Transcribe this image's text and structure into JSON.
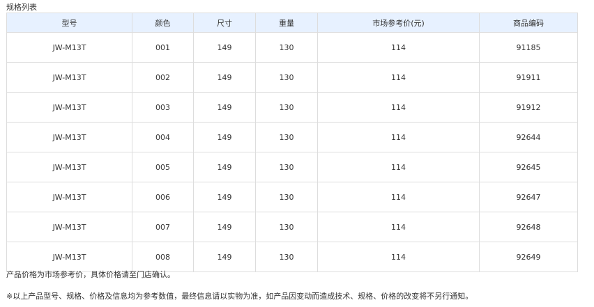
{
  "section_title": "规格列表",
  "table": {
    "columns": [
      "型号",
      "颜色",
      "尺寸",
      "重量",
      "市场参考价(元)",
      "商品编码"
    ],
    "rows": [
      [
        "JW-M13T",
        "001",
        "149",
        "130",
        "114",
        "91185"
      ],
      [
        "JW-M13T",
        "002",
        "149",
        "130",
        "114",
        "91911"
      ],
      [
        "JW-M13T",
        "003",
        "149",
        "130",
        "114",
        "91912"
      ],
      [
        "JW-M13T",
        "004",
        "149",
        "130",
        "114",
        "92644"
      ],
      [
        "JW-M13T",
        "005",
        "149",
        "130",
        "114",
        "92645"
      ],
      [
        "JW-M13T",
        "006",
        "149",
        "130",
        "114",
        "92647"
      ],
      [
        "JW-M13T",
        "007",
        "149",
        "130",
        "114",
        "92648"
      ],
      [
        "JW-M13T",
        "008",
        "149",
        "130",
        "114",
        "92649"
      ]
    ]
  },
  "notes": {
    "price_note": "产品价格为市场参考价，具体价格请至门店确认。",
    "disclaimer": "※以上产品型号、规格、价格及信息均为参考数值，最终信息请以实物为准，如产品因变动而造成技术、规格、价格的改变将不另行通知。"
  },
  "colors": {
    "header_bg": "#e7f1ff",
    "border": "#dddddd",
    "text": "#333333"
  }
}
